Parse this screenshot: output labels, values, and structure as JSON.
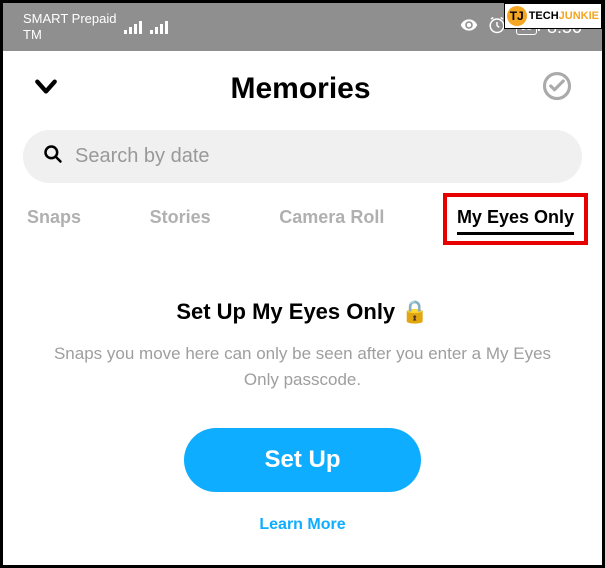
{
  "watermark": {
    "logo_text": "TJ",
    "text1": "TECH",
    "text2": "JUNKIE"
  },
  "statusbar": {
    "carrier_line1": "SMART Prepaid",
    "carrier_line2": "TM",
    "battery": "58",
    "time": "8:50"
  },
  "header": {
    "title": "Memories"
  },
  "search": {
    "placeholder": "Search by date"
  },
  "tabs": {
    "snaps": "Snaps",
    "stories": "Stories",
    "camera_roll": "Camera Roll",
    "my_eyes_only": "My Eyes Only"
  },
  "setup": {
    "title": "Set Up My Eyes Only 🔒",
    "description": "Snaps you move here can only be seen after you enter a My Eyes Only passcode.",
    "button": "Set Up",
    "learn_more": "Learn More"
  }
}
